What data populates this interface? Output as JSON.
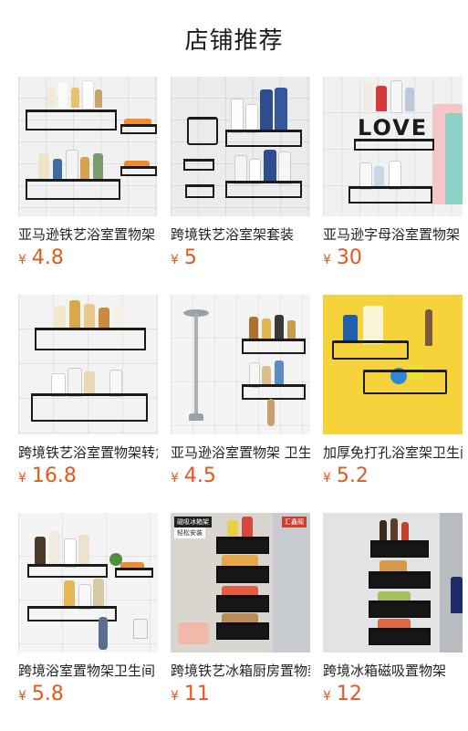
{
  "header": {
    "title": "店铺推荐"
  },
  "currency_symbol": "¥",
  "colors": {
    "price": "#e4571e",
    "title": "#1a1a1a"
  },
  "products": [
    {
      "name": "亚马逊铁艺浴室置物架",
      "price": "4.8"
    },
    {
      "name": "跨境铁艺浴室架套装",
      "price": "5"
    },
    {
      "name": "亚马逊字母浴室置物架",
      "price": "30",
      "image_text": "LOVE"
    },
    {
      "name": "跨境铁艺浴室置物架转角",
      "price": "16.8"
    },
    {
      "name": "亚马逊浴室置物架 卫生间",
      "price": "4.5"
    },
    {
      "name": "加厚免打孔浴室架卫生间",
      "price": "5.2"
    },
    {
      "name": "跨境浴室置物架卫生间",
      "price": "5.8"
    },
    {
      "name": "跨境铁艺冰箱厨房置物架",
      "price": "11",
      "image_badges": [
        "磁吸冰箱架",
        "轻松安装",
        "汇鑫阁"
      ]
    },
    {
      "name": "跨境冰箱磁吸置物架",
      "price": "12"
    }
  ]
}
